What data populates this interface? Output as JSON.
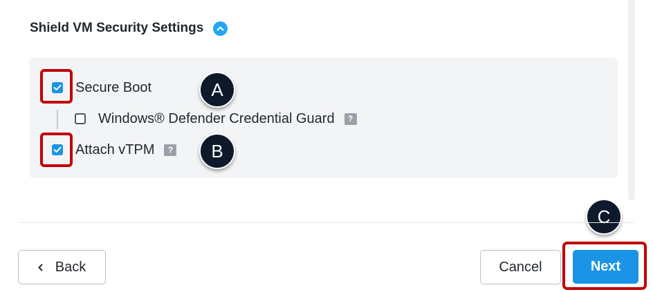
{
  "section": {
    "title": "Shield VM Security Settings",
    "collapse_icon": "chevron-up-icon"
  },
  "options": [
    {
      "label": "Secure Boot",
      "checked": true
    },
    {
      "label": "Windows® Defender Credential Guard",
      "checked": false,
      "help": "?"
    },
    {
      "label": "Attach vTPM",
      "checked": true,
      "help": "?"
    }
  ],
  "callouts": {
    "a": "A",
    "b": "B",
    "c": "C"
  },
  "footer": {
    "back_label": "Back",
    "back_icon": "chevron-left-icon",
    "cancel_label": "Cancel",
    "next_label": "Next"
  },
  "colors": {
    "accent": "#1b94e6",
    "highlight": "#c00000",
    "callout": "#0e1a2b"
  }
}
